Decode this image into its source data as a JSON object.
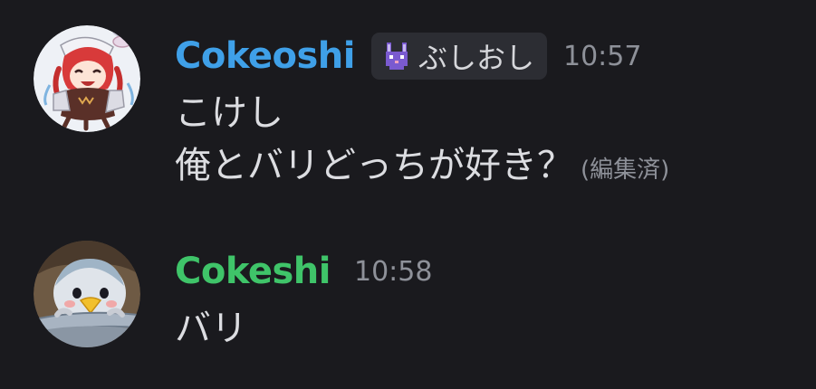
{
  "messages": [
    {
      "username": "Cokeoshi",
      "username_color": "#3fa0e8",
      "avatar_icon": "anime-avatar-icon",
      "role": {
        "icon": "bunny-icon",
        "label": "ぶしおし"
      },
      "timestamp": "10:57",
      "lines": [
        "こけし",
        "俺とバリどっちが好き？"
      ],
      "edited_label": "(編集済)"
    },
    {
      "username": "Cokeshi",
      "username_color": "#3fc469",
      "avatar_icon": "penguin-plush-avatar-icon",
      "timestamp": "10:58",
      "lines": [
        "バリ"
      ]
    }
  ]
}
